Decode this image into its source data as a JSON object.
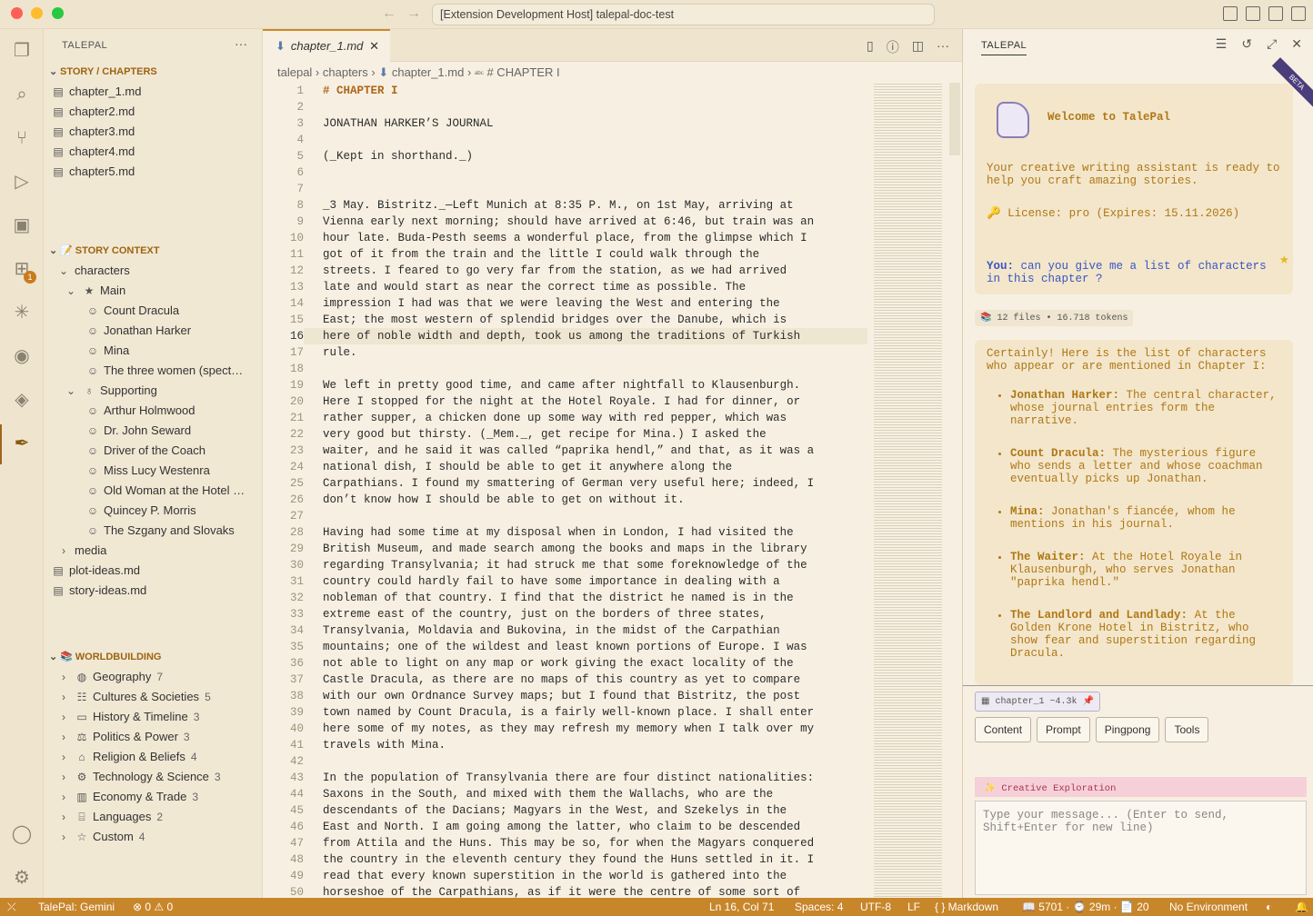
{
  "window": {
    "title": "[Extension Development Host] talepal-doc-test"
  },
  "sidebar": {
    "title": "TALEPAL",
    "story_section": "STORY / CHAPTERS",
    "chapters": [
      "chapter_1.md",
      "chapter2.md",
      "chapter3.md",
      "chapter4.md",
      "chapter5.md"
    ],
    "context_section": "STORY CONTEXT",
    "characters_label": "characters",
    "main_label": "Main",
    "main_chars": [
      "Count Dracula",
      "Jonathan Harker",
      "Mina",
      "The three women (spect…"
    ],
    "supporting_label": "Supporting",
    "supporting_chars": [
      "Arthur Holmwood",
      "Dr. John Seward",
      "Driver of the Coach",
      "Miss Lucy Westenra",
      "Old Woman at the Hotel …",
      "Quincey P. Morris",
      "The Szgany and Slovaks"
    ],
    "media_label": "media",
    "plot_ideas": "plot-ideas.md",
    "story_ideas": "story-ideas.md",
    "world_section": "WORLDBUILDING",
    "world": [
      {
        "label": "Geography",
        "count": "7",
        "icon": "globe-icon"
      },
      {
        "label": "Cultures & Societies",
        "count": "5",
        "icon": "people-icon"
      },
      {
        "label": "History & Timeline",
        "count": "3",
        "icon": "book-icon"
      },
      {
        "label": "Politics & Power",
        "count": "3",
        "icon": "scales-icon"
      },
      {
        "label": "Religion & Beliefs",
        "count": "4",
        "icon": "temple-icon"
      },
      {
        "label": "Technology & Science",
        "count": "3",
        "icon": "gear-icon"
      },
      {
        "label": "Economy & Trade",
        "count": "3",
        "icon": "chart-icon"
      },
      {
        "label": "Languages",
        "count": "2",
        "icon": "language-icon"
      },
      {
        "label": "Custom",
        "count": "4",
        "icon": "star-icon"
      }
    ]
  },
  "editor": {
    "tab": "chapter_1.md",
    "breadcrumb": [
      "talepal",
      "chapters",
      "chapter_1.md",
      "# CHAPTER I"
    ],
    "current_line": 16,
    "lines": [
      "# CHAPTER I",
      "",
      "JONATHAN HARKER’S JOURNAL",
      "",
      "(_Kept in shorthand._)",
      "",
      "",
      "_3 May. Bistritz._—Left Munich at 8:35 P. M., on 1st May, arriving at",
      "Vienna early next morning; should have arrived at 6:46, but train was an",
      "hour late. Buda-Pesth seems a wonderful place, from the glimpse which I",
      "got of it from the train and the little I could walk through the",
      "streets. I feared to go very far from the station, as we had arrived",
      "late and would start as near the correct time as possible. The",
      "impression I had was that we were leaving the West and entering the",
      "East; the most western of splendid bridges over the Danube, which is",
      "here of noble width and depth, took us among the traditions of Turkish",
      "rule.",
      "",
      "We left in pretty good time, and came after nightfall to Klausenburgh.",
      "Here I stopped for the night at the Hotel Royale. I had for dinner, or",
      "rather supper, a chicken done up some way with red pepper, which was",
      "very good but thirsty. (_Mem._, get recipe for Mina.) I asked the",
      "waiter, and he said it was called “paprika hendl,” and that, as it was a",
      "national dish, I should be able to get it anywhere along the",
      "Carpathians. I found my smattering of German very useful here; indeed, I",
      "don’t know how I should be able to get on without it.",
      "",
      "Having had some time at my disposal when in London, I had visited the",
      "British Museum, and made search among the books and maps in the library",
      "regarding Transylvania; it had struck me that some foreknowledge of the",
      "country could hardly fail to have some importance in dealing with a",
      "nobleman of that country. I find that the district he named is in the",
      "extreme east of the country, just on the borders of three states,",
      "Transylvania, Moldavia and Bukovina, in the midst of the Carpathian",
      "mountains; one of the wildest and least known portions of Europe. I was",
      "not able to light on any map or work giving the exact locality of the",
      "Castle Dracula, as there are no maps of this country as yet to compare",
      "with our own Ordnance Survey maps; but I found that Bistritz, the post",
      "town named by Count Dracula, is a fairly well-known place. I shall enter",
      "here some of my notes, as they may refresh my memory when I talk over my",
      "travels with Mina.",
      "",
      "In the population of Transylvania there are four distinct nationalities:",
      "Saxons in the South, and mixed with them the Wallachs, who are the",
      "descendants of the Dacians; Magyars in the West, and Szekelys in the",
      "East and North. I am going among the latter, who claim to be descended",
      "from Attila and the Huns. This may be so, for when the Magyars conquered",
      "the country in the eleventh century they found the Huns settled in it. I",
      "read that every known superstition in the world is gathered into the",
      "horseshoe of the Carpathians, as if it were the centre of some sort of"
    ]
  },
  "panel": {
    "title": "TALEPAL",
    "beta": "BETA",
    "welcome_title": "Welcome to TalePal",
    "welcome_text": "Your creative writing assistant is ready to help you craft amazing stories.",
    "license": "🔑 License: pro (Expires: 15.11.2026)",
    "you_label": "You:",
    "you_text": "can you give me a list of characters in this chapter ?",
    "files": "📚 12 files • 16.718 tokens",
    "answer_intro": "Certainly! Here is the list of characters who appear or are mentioned in Chapter I:",
    "answer_items": [
      {
        "name": "Jonathan Harker:",
        "text": "The central character, whose journal entries form the narrative."
      },
      {
        "name": "Count Dracula:",
        "text": "The mysterious figure who sends a letter and whose coachman eventually picks up Jonathan."
      },
      {
        "name": "Mina:",
        "text": "Jonathan's fiancée, whom he mentions in his journal."
      },
      {
        "name": "The Waiter:",
        "text": "At the Hotel Royale in Klausenburgh, who serves Jonathan \"paprika hendl.\""
      },
      {
        "name": "The Landlord and Landlady:",
        "text": "At the Golden Krone Hotel in Bistritz, who show fear and superstition regarding Dracula."
      }
    ],
    "chip": "chapter_1 ~4.3k",
    "buttons": [
      "Content",
      "Prompt",
      "Pingpong",
      "Tools"
    ],
    "mode": "✨ Creative Exploration",
    "input_placeholder": "Type your message... (Enter to send, Shift+Enter for new line)"
  },
  "status": {
    "provider": "TalePal: Gemini",
    "problems": "⊗ 0 ⚠ 0",
    "position": "Ln 16, Col 71",
    "spaces": "Spaces: 4",
    "encoding": "UTF-8",
    "eol": "LF",
    "language": "{ } Markdown",
    "stats": "📖 5701 · ⌚ 29m · 📄 20",
    "env": "No Environment"
  }
}
